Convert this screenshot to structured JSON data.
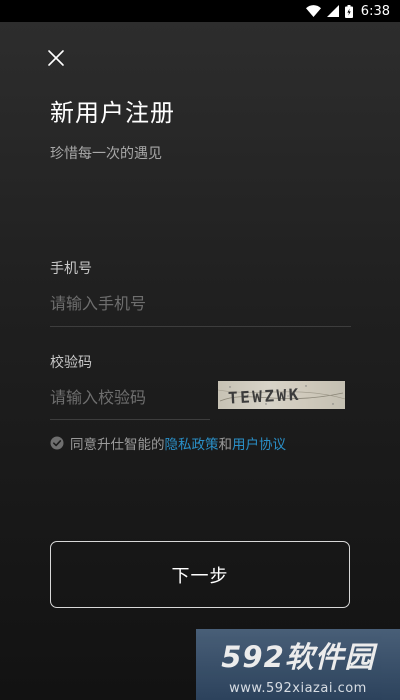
{
  "status_bar": {
    "time": "6:38",
    "icons": [
      "wifi-icon",
      "cellular-signal-icon",
      "battery-icon"
    ]
  },
  "header": {
    "close_icon": "close-icon",
    "title": "新用户注册",
    "subtitle": "珍惜每一次的遇见"
  },
  "form": {
    "phone": {
      "label": "手机号",
      "placeholder": "请输入手机号",
      "value": ""
    },
    "code": {
      "label": "校验码",
      "placeholder": "请输入校验码",
      "value": "",
      "captcha_text": "TEWZWK"
    }
  },
  "agreement": {
    "prefix": "同意升仕智能的",
    "privacy_link": "隐私政策",
    "conjunction": "和",
    "terms_link": "用户协议",
    "checked": true
  },
  "next_button": {
    "label": "下一步"
  },
  "watermark": {
    "logo_text": "592软件园",
    "url": "www.592xiazai.com"
  },
  "colors": {
    "background_top": "#2e2e2e",
    "background_bottom": "#121212",
    "link": "#2a8fc7",
    "placeholder": "#6e6e6e",
    "divider": "#3d3d3d",
    "watermark_bg": "#3e5672"
  }
}
